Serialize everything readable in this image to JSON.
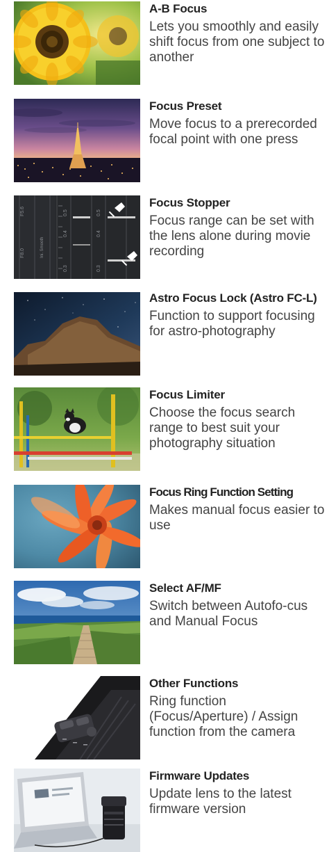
{
  "features": [
    {
      "title": "A-B Focus",
      "desc": "Lets you smoothly and easily shift focus from one subject to another",
      "image": "sunflowers"
    },
    {
      "title": "Focus Preset",
      "desc": "Move focus to a prerecorded focal point with one press",
      "image": "eiffel-tower-dusk"
    },
    {
      "title": "Focus Stopper",
      "desc": "Focus range can be set with the lens alone during movie recording",
      "image": "focus-scale-pins",
      "scale": {
        "f_top": "F5.6",
        "f_bottom": "F8.0",
        "mode": "Ini. Smooth",
        "v1": "0.5",
        "v2": "0.4",
        "v3": "0.3"
      }
    },
    {
      "title": "Astro Focus Lock (Astro FC-L)",
      "desc": "Function to support focusing for astro-photography",
      "image": "night-sky-cliff"
    },
    {
      "title": "Focus Limiter",
      "desc": "Choose the focus search range to best suit your photography situation",
      "image": "dog-jumping"
    },
    {
      "title": "Focus Ring Function Setting",
      "desc": "Makes manual focus easier to use",
      "image": "orange-flower"
    },
    {
      "title": "Select AF/MF",
      "desc": "Switch between Autofo-cus and Manual Focus",
      "image": "coastal-path"
    },
    {
      "title": "Other Functions",
      "desc": "Ring function (Focus/Aperture) / Assign function from the camera",
      "image": "lens-buttons"
    },
    {
      "title": "Firmware Updates",
      "desc": "Update lens to the latest firmware version",
      "image": "laptop-lens"
    }
  ]
}
